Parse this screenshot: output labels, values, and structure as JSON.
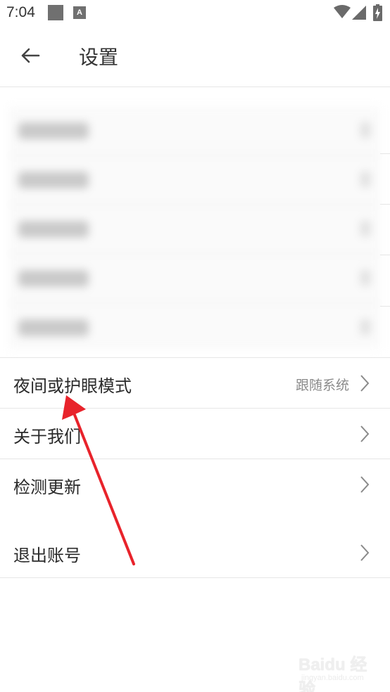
{
  "status_bar": {
    "time": "7:04",
    "icons": [
      "notification-square-icon",
      "accessibility-a-icon",
      "wifi-icon",
      "signal-icon",
      "battery-charging-icon"
    ]
  },
  "app_bar": {
    "back_icon": "arrow-left-icon",
    "title": "设置"
  },
  "settings": [
    {
      "label": "夜间或护眼模式",
      "value": "跟随系统",
      "icon": "chevron-right-icon"
    },
    {
      "label": "关于我们",
      "value": "",
      "icon": "chevron-right-icon"
    },
    {
      "label": "检测更新",
      "value": "",
      "icon": "chevron-right-icon"
    },
    {
      "label": "退出账号",
      "value": "",
      "icon": "chevron-right-icon"
    }
  ],
  "annotation": {
    "color": "#e8232b"
  },
  "watermark": {
    "main": "Baidu 经验",
    "sub": "jingyan.baidu.com"
  },
  "colors": {
    "divider": "#e6e6e6",
    "secondary_text": "#8a8a8a",
    "primary_text": "#2a2a2a"
  }
}
